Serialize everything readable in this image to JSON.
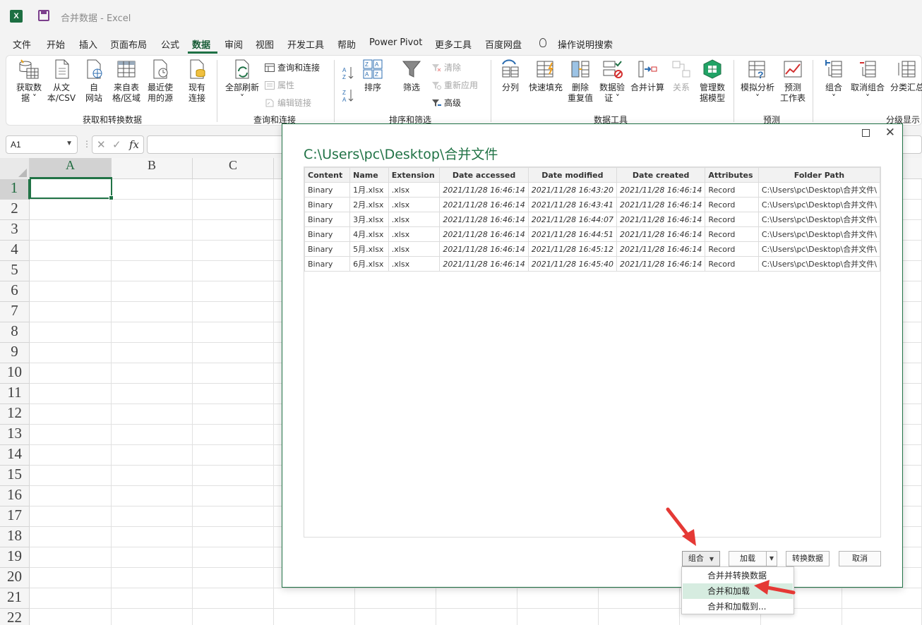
{
  "window": {
    "title": "合并数据 - Excel",
    "app_icon": "X"
  },
  "tabs": [
    "文件",
    "开始",
    "插入",
    "页面布局",
    "公式",
    "数据",
    "审阅",
    "视图",
    "开发工具",
    "帮助",
    "Power Pivot",
    "更多工具",
    "百度网盘",
    "操作说明搜索"
  ],
  "ribbon": {
    "get_data": {
      "l1": "获取数",
      "l2": "据 ˅"
    },
    "from_csv": {
      "l1": "从文",
      "l2": "本/CSV"
    },
    "from_web": {
      "l1": "自",
      "l2": "网站"
    },
    "from_table": {
      "l1": "来自表",
      "l2": "格/区域"
    },
    "recent": {
      "l1": "最近使",
      "l2": "用的源"
    },
    "existing": {
      "l1": "现有",
      "l2": "连接"
    },
    "group1": "获取和转换数据",
    "refresh_all": {
      "l1": "全部刷新",
      "l2": "˅"
    },
    "queries": "查询和连接",
    "properties": "属性",
    "edit_links": "编辑链接",
    "group2": "查询和连接",
    "sort": "排序",
    "filter": "筛选",
    "clear": "清除",
    "reapply": "重新应用",
    "advanced": "高级",
    "group3": "排序和筛选",
    "split": "分列",
    "flash_fill": "快速填充",
    "remove_dup": {
      "l1": "删除",
      "l2": "重复值"
    },
    "validation": {
      "l1": "数据验",
      "l2": "证 ˅"
    },
    "consolidate": "合并计算",
    "relations": "关系",
    "data_model": {
      "l1": "管理数",
      "l2": "据模型"
    },
    "group4": "数据工具",
    "what_if": {
      "l1": "模拟分析",
      "l2": "˅"
    },
    "forecast": {
      "l1": "预测",
      "l2": "工作表"
    },
    "group5": "预测",
    "group_btn": {
      "l1": "组合",
      "l2": "˅"
    },
    "ungroup": {
      "l1": "取消组合",
      "l2": "˅"
    },
    "subtotal": "分类汇总",
    "group6": "分级显示"
  },
  "formula_bar": {
    "name_box": "A1",
    "fx": "fx",
    "cancel": "✕",
    "enter": "✓",
    "value": ""
  },
  "sheet": {
    "columns": [
      "A",
      "B",
      "C"
    ],
    "rows": [
      "1",
      "2",
      "3",
      "4",
      "5",
      "6",
      "7",
      "8",
      "9",
      "10",
      "11",
      "12",
      "13",
      "14",
      "15",
      "16",
      "17",
      "18",
      "19",
      "20",
      "21",
      "22"
    ],
    "active_cell": "A1"
  },
  "dialog": {
    "path": "C:\\Users\\pc\\Desktop\\合并文件",
    "columns": [
      "Content",
      "Name",
      "Extension",
      "Date accessed",
      "Date modified",
      "Date created",
      "Attributes",
      "Folder Path"
    ],
    "rows": [
      [
        "Binary",
        "1月.xlsx",
        ".xlsx",
        "2021/11/28 16:46:14",
        "2021/11/28 16:43:20",
        "2021/11/28 16:46:14",
        "Record",
        "C:\\Users\\pc\\Desktop\\合并文件\\"
      ],
      [
        "Binary",
        "2月.xlsx",
        ".xlsx",
        "2021/11/28 16:46:14",
        "2021/11/28 16:43:41",
        "2021/11/28 16:46:14",
        "Record",
        "C:\\Users\\pc\\Desktop\\合并文件\\"
      ],
      [
        "Binary",
        "3月.xlsx",
        ".xlsx",
        "2021/11/28 16:46:14",
        "2021/11/28 16:44:07",
        "2021/11/28 16:46:14",
        "Record",
        "C:\\Users\\pc\\Desktop\\合并文件\\"
      ],
      [
        "Binary",
        "4月.xlsx",
        ".xlsx",
        "2021/11/28 16:46:14",
        "2021/11/28 16:44:51",
        "2021/11/28 16:46:14",
        "Record",
        "C:\\Users\\pc\\Desktop\\合并文件\\"
      ],
      [
        "Binary",
        "5月.xlsx",
        ".xlsx",
        "2021/11/28 16:46:14",
        "2021/11/28 16:45:12",
        "2021/11/28 16:46:14",
        "Record",
        "C:\\Users\\pc\\Desktop\\合并文件\\"
      ],
      [
        "Binary",
        "6月.xlsx",
        ".xlsx",
        "2021/11/28 16:46:14",
        "2021/11/28 16:45:40",
        "2021/11/28 16:46:14",
        "Record",
        "C:\\Users\\pc\\Desktop\\合并文件\\"
      ]
    ],
    "buttons": {
      "combine": "组合",
      "load": "加载",
      "transform": "转换数据",
      "cancel": "取消"
    },
    "combine_menu": [
      "合并并转换数据",
      "合并和加载",
      "合并和加载到..."
    ]
  },
  "colors": {
    "accent": "#217346",
    "annotation": "#e53935",
    "menu_highlight": "#d6ece0"
  },
  "icons": {
    "dialog_maximize": "maximize-icon",
    "dialog_close": "close-icon"
  }
}
